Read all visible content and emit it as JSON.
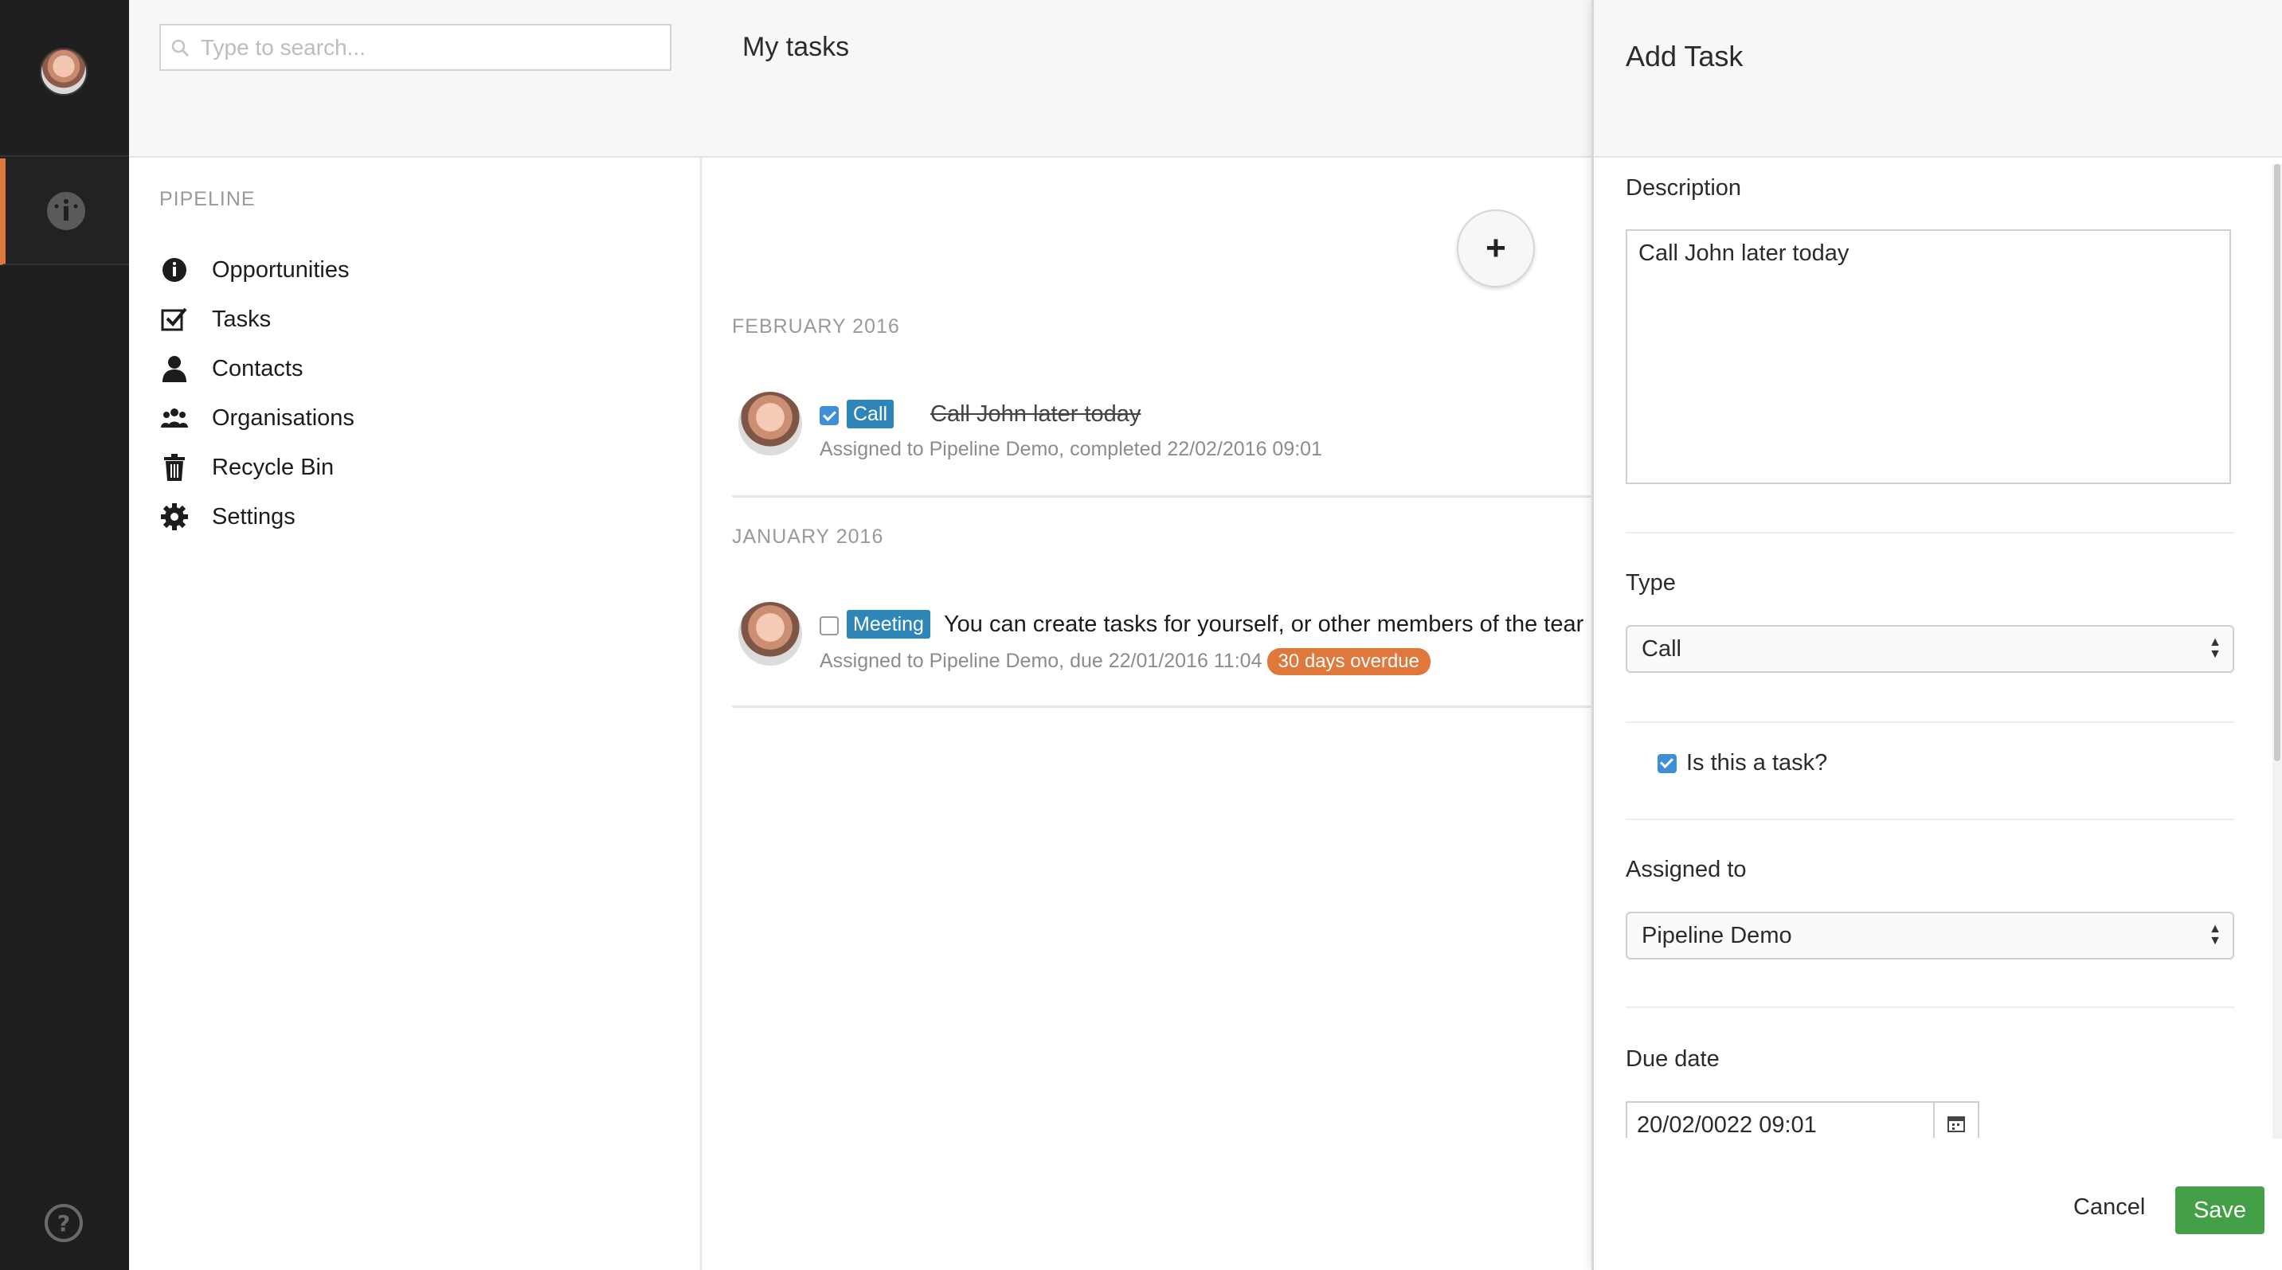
{
  "rail": {
    "dashboard_icon": "dashboard-gauge-icon",
    "help_icon": "question-circle-icon",
    "accent_color": "#e0773b"
  },
  "sidebar": {
    "search_placeholder": "Type to search...",
    "section_title": "PIPELINE",
    "items": [
      {
        "label": "Opportunities",
        "icon": "gauge-icon"
      },
      {
        "label": "Tasks",
        "icon": "checkbox-icon"
      },
      {
        "label": "Contacts",
        "icon": "person-icon"
      },
      {
        "label": "Organisations",
        "icon": "group-icon"
      },
      {
        "label": "Recycle Bin",
        "icon": "trash-icon"
      },
      {
        "label": "Settings",
        "icon": "gear-icon"
      }
    ]
  },
  "main": {
    "title": "My tasks",
    "add_label": "+",
    "groups": [
      {
        "month": "FEBRUARY 2016",
        "tasks": [
          {
            "checked": true,
            "type": "Call",
            "description": "Call John later today",
            "meta": "Assigned to Pipeline Demo, completed 22/02/2016 09:01"
          }
        ]
      },
      {
        "month": "JANUARY 2016",
        "tasks": [
          {
            "checked": false,
            "type": "Meeting",
            "description": "You can create tasks for yourself, or other members of the tear",
            "meta": "Assigned to Pipeline Demo, due 22/01/2016 11:04",
            "overdue": "30 days overdue"
          }
        ]
      }
    ]
  },
  "panel": {
    "title": "Add Task",
    "description_label": "Description",
    "description_value": "Call John later today",
    "type_label": "Type",
    "type_value": "Call",
    "is_task_label": "Is this a task?",
    "is_task_checked": true,
    "assigned_label": "Assigned to",
    "assigned_value": "Pipeline Demo",
    "due_label": "Due date",
    "due_value": "20/02/0022 09:01",
    "cancel_label": "Cancel",
    "save_label": "Save",
    "save_color": "#43a047"
  }
}
